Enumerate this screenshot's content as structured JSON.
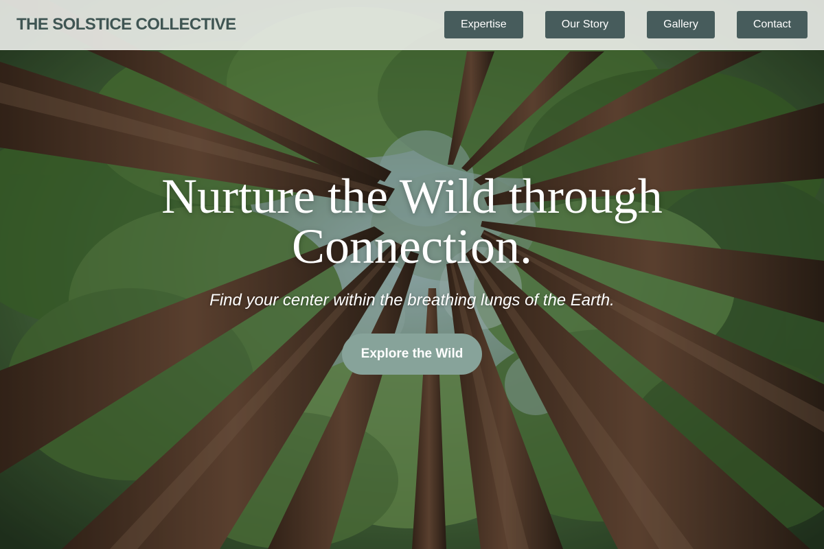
{
  "header": {
    "brand": "THE SOLSTICE COLLECTIVE",
    "nav": [
      {
        "label": "Expertise"
      },
      {
        "label": "Our Story"
      },
      {
        "label": "Gallery"
      },
      {
        "label": "Contact"
      }
    ]
  },
  "hero": {
    "title": "Nurture the Wild through Connection.",
    "subtitle": "Find your center within the breathing lungs of the Earth.",
    "cta_label": "Explore the Wild"
  },
  "colors": {
    "header_bg": "#eceeea",
    "brand_text": "#3f5553",
    "nav_button": "#475c5c",
    "cta_button": "#87a39a",
    "hero_text": "#ffffff"
  }
}
